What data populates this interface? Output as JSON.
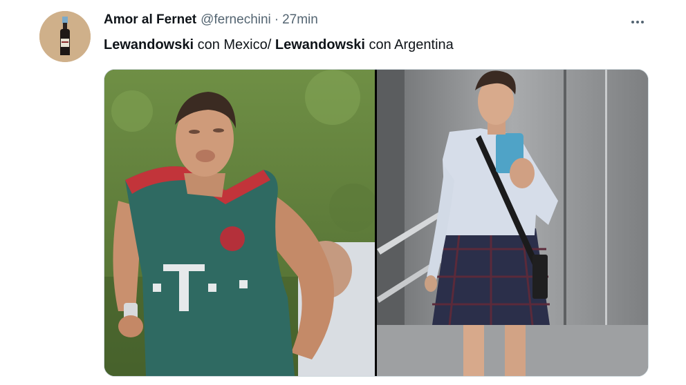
{
  "tweet": {
    "author": {
      "display_name": "Amor al Fernet",
      "handle": "@fernechini",
      "separator": "·",
      "time": "27min",
      "avatar_icon": "fernet-bottle-icon"
    },
    "text": {
      "part1_bold": "Lewandowski",
      "part2": " con Mexico/ ",
      "part3_bold": "Lewandowski",
      "part4": " con Argentina"
    },
    "more_icon": "more-options-icon",
    "media": [
      {
        "name": "photo-left",
        "description_icon": "football-player-photo"
      },
      {
        "name": "photo-right",
        "description_icon": "elevator-selfie-photo"
      }
    ]
  },
  "colors": {
    "text_primary": "#0f1419",
    "text_secondary": "#536471",
    "border": "#cfd9de",
    "avatar_bg": "#cfb08a"
  }
}
